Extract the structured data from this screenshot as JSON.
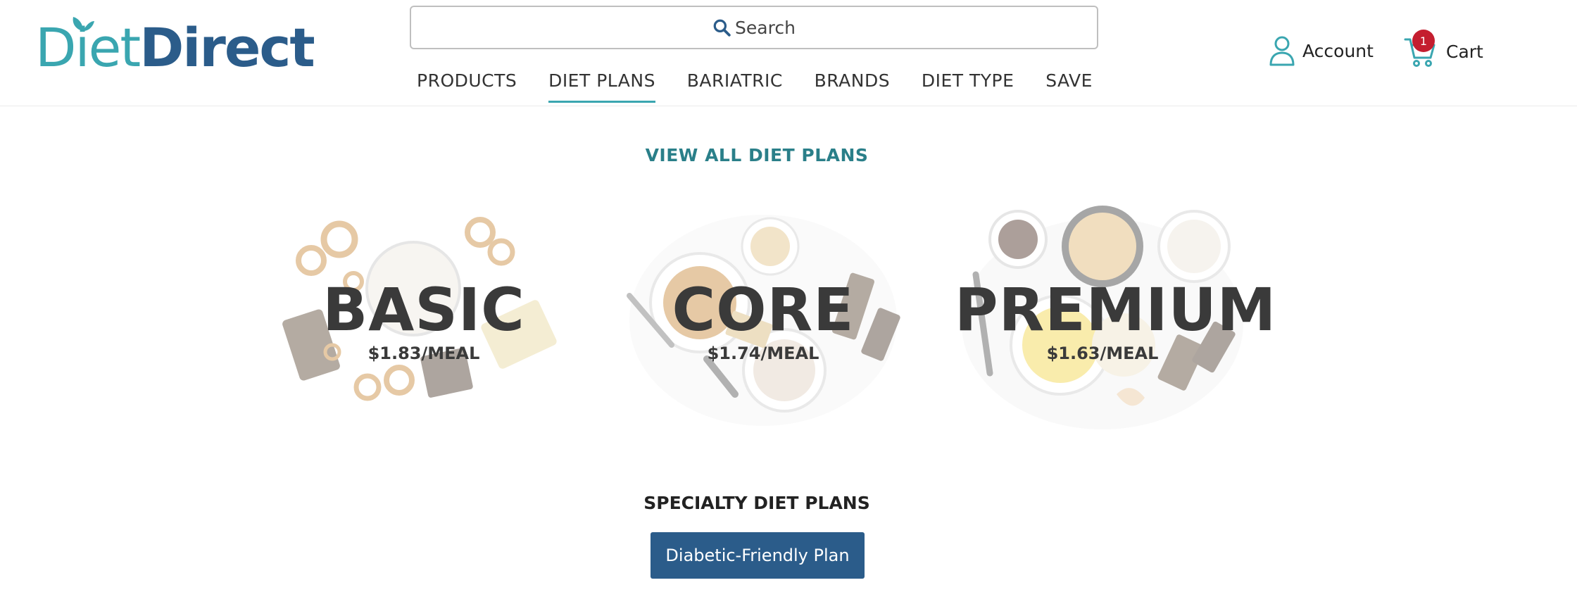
{
  "brand": {
    "logo_part1": "Diet",
    "logo_part2": "Direct",
    "color_primary": "#2b5c8a",
    "color_accent": "#3aa6b0"
  },
  "search": {
    "placeholder": "Search",
    "icon": "search-icon"
  },
  "nav": {
    "items": [
      {
        "label": "PRODUCTS"
      },
      {
        "label": "DIET PLANS",
        "active": true
      },
      {
        "label": "BARIATRIC"
      },
      {
        "label": "BRANDS"
      },
      {
        "label": "DIET TYPE"
      },
      {
        "label": "SAVE"
      }
    ]
  },
  "account": {
    "label": "Account",
    "icon": "user-icon"
  },
  "cart": {
    "label": "Cart",
    "count": "1",
    "icon": "cart-icon",
    "badge_color": "#c41e2f"
  },
  "main": {
    "view_all_label": "VIEW ALL DIET PLANS",
    "plans": [
      {
        "name": "BASIC",
        "price": "$1.83/MEAL"
      },
      {
        "name": "CORE",
        "price": "$1.74/MEAL"
      },
      {
        "name": "PREMIUM",
        "price": "$1.63/MEAL"
      }
    ],
    "specialty_title": "SPECIALTY DIET PLANS",
    "specialty_button": "Diabetic-Friendly Plan"
  }
}
